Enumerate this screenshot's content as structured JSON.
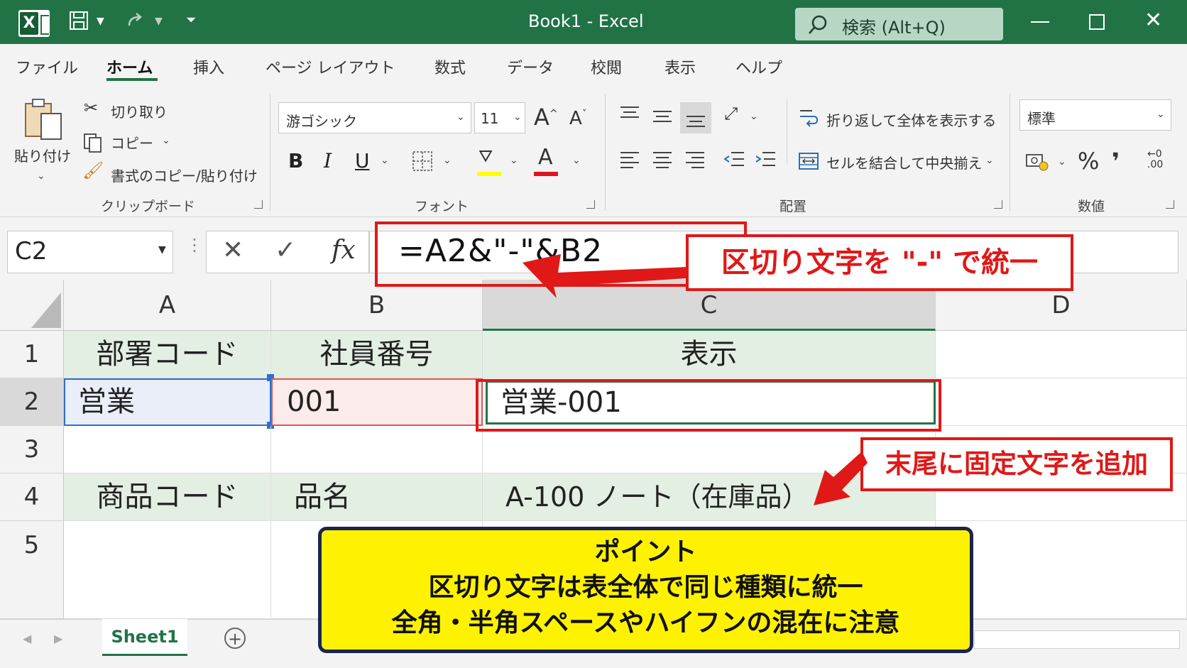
{
  "titlebar": {
    "title": "Book1  -  Excel",
    "search_placeholder": "検索 (Alt+Q)"
  },
  "menu": {
    "tabs": [
      "ファイル",
      "ホーム",
      "挿入",
      "ページ レイアウト",
      "数式",
      "データ",
      "校閲",
      "表示",
      "ヘルプ"
    ],
    "active": "ホーム"
  },
  "ribbon": {
    "clipboard": {
      "paste": "貼り付け",
      "cut": "切り取り",
      "copy": "コピー",
      "format_painter": "書式のコピー/貼り付け",
      "group_label": "クリップボード"
    },
    "font": {
      "font_name": "游ゴシック",
      "font_size": "11",
      "bold": "B",
      "italic": "I",
      "underline": "U",
      "font_color_letter": "A",
      "grow": "A",
      "shrink": "A",
      "group_label": "フォント",
      "highlight_color": "#ffff00",
      "font_color": "#e0141e"
    },
    "alignment": {
      "wrap_text": "折り返して全体を表示する",
      "merge_center": "セルを結合して中央揃え",
      "group_label": "配置"
    },
    "number": {
      "format": "標準",
      "percent": "%",
      "comma": "❜",
      "group_label": "数値"
    }
  },
  "formula_bar": {
    "name_box": "C2",
    "fx": "fx",
    "formula": "=A2&\"-\"&B2"
  },
  "grid": {
    "columns": [
      "A",
      "B",
      "C",
      "D"
    ],
    "rows": [
      "1",
      "2",
      "3",
      "4",
      "5"
    ],
    "r1": {
      "a": "部署コード",
      "b": "社員番号",
      "c": "表示"
    },
    "r2": {
      "a": "営業",
      "b": "001",
      "c": "営業-001"
    },
    "r4": {
      "a": "商品コード",
      "b": "品名",
      "c": "A-100 ノート（在庫品）"
    }
  },
  "sheets": {
    "active": "Sheet1"
  },
  "annotations": {
    "callout1": "区切り文字を \"-\" で統一",
    "callout2": "末尾に固定文字を追加",
    "point_title": "ポイント",
    "point_line1": "区切り文字は表全体で同じ種類に統一",
    "point_line2": "全角・半角スペースやハイフンの混在に注意"
  },
  "colors": {
    "excel_green": "#217346",
    "callout_red": "#e01818",
    "point_yellow": "#fff200",
    "point_border": "#1b2550"
  }
}
